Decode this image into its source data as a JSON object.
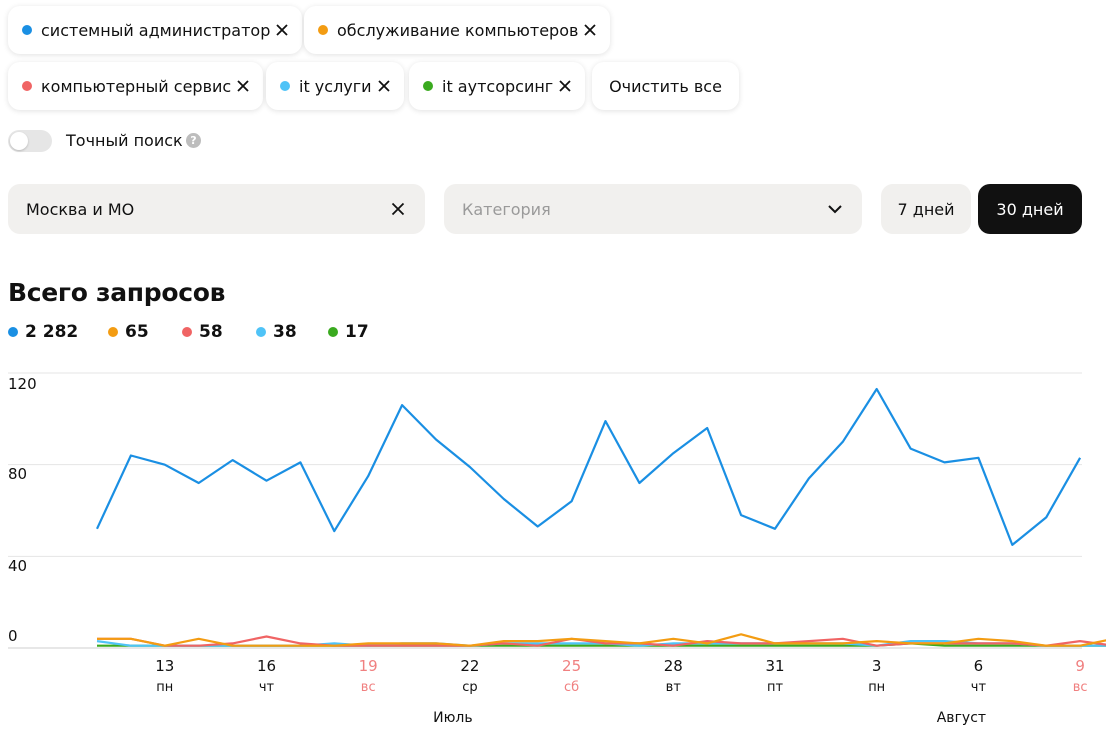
{
  "tags": [
    {
      "label": "системный администратор",
      "color": "#1a8fe3"
    },
    {
      "label": "обслуживание компьютеров",
      "color": "#f39c12"
    },
    {
      "label": "компьютерный сервис",
      "color": "#f06464"
    },
    {
      "label": "it услуги",
      "color": "#4fc3f7"
    },
    {
      "label": "it аутсорсинг",
      "color": "#3aaa1f"
    }
  ],
  "clear_all_label": "Очистить все",
  "exact_search_label": "Точный поиск",
  "help_glyph": "?",
  "region": {
    "value": "Москва и МО"
  },
  "category": {
    "placeholder": "Категория"
  },
  "period": {
    "seven_days": "7 дней",
    "thirty_days": "30 дней",
    "selected": "30 дней"
  },
  "totals_title": "Всего запросов",
  "totals": [
    {
      "value": "2 282",
      "color": "#1a8fe3"
    },
    {
      "value": "65",
      "color": "#f39c12"
    },
    {
      "value": "58",
      "color": "#f06464"
    },
    {
      "value": "38",
      "color": "#4fc3f7"
    },
    {
      "value": "17",
      "color": "#3aaa1f"
    }
  ],
  "chart_data": {
    "type": "line",
    "x": [
      "11",
      "12",
      "13",
      "14",
      "15",
      "16",
      "17",
      "18",
      "19",
      "20",
      "21",
      "22",
      "23",
      "24",
      "25",
      "26",
      "27",
      "28",
      "29",
      "30",
      "31",
      "1",
      "2",
      "3",
      "4",
      "5",
      "6",
      "7",
      "8",
      "9",
      "10"
    ],
    "y_ticks": [
      0,
      40,
      80,
      120
    ],
    "ylim": [
      0,
      120
    ],
    "x_tick_labels": [
      {
        "day": "13",
        "weekday": "пн",
        "weekend": false
      },
      {
        "day": "16",
        "weekday": "чт",
        "weekend": false
      },
      {
        "day": "19",
        "weekday": "вс",
        "weekend": true
      },
      {
        "day": "22",
        "weekday": "ср",
        "weekend": false
      },
      {
        "day": "25",
        "weekday": "сб",
        "weekend": true
      },
      {
        "day": "28",
        "weekday": "вт",
        "weekend": false
      },
      {
        "day": "31",
        "weekday": "пт",
        "weekend": false
      },
      {
        "day": "3",
        "weekday": "пн",
        "weekend": false
      },
      {
        "day": "6",
        "weekday": "чт",
        "weekend": false
      },
      {
        "day": "9",
        "weekday": "вс",
        "weekend": true
      }
    ],
    "months": [
      {
        "label": "Июль",
        "at": "22"
      },
      {
        "label": "Август",
        "at": "6"
      }
    ],
    "grid": true,
    "weekend_color": "#f08080",
    "series": [
      {
        "color": "#1a8fe3",
        "values": [
          52,
          84,
          80,
          72,
          82,
          73,
          81,
          51,
          75,
          106,
          91,
          79,
          65,
          53,
          64,
          99,
          72,
          85,
          96,
          58,
          52,
          74,
          90,
          113,
          87,
          81,
          83,
          45,
          57,
          83
        ]
      },
      {
        "color": "#f39c12",
        "values": [
          4,
          4,
          1,
          4,
          1,
          1,
          1,
          1,
          2,
          2,
          2,
          1,
          3,
          3,
          4,
          3,
          2,
          4,
          2,
          6,
          2,
          2,
          2,
          3,
          2,
          2,
          4,
          3,
          1,
          1,
          4
        ]
      },
      {
        "color": "#f06464",
        "values": [
          4,
          4,
          1,
          1,
          2,
          5,
          2,
          1,
          1,
          1,
          1,
          1,
          2,
          1,
          4,
          2,
          2,
          1,
          3,
          2,
          2,
          3,
          4,
          1,
          2,
          2,
          2,
          2,
          1,
          3,
          1
        ]
      },
      {
        "color": "#4fc3f7",
        "values": [
          3,
          1,
          1,
          1,
          1,
          1,
          1,
          2,
          1,
          2,
          2,
          1,
          2,
          2,
          2,
          2,
          1,
          2,
          2,
          2,
          2,
          2,
          2,
          1,
          3,
          3,
          2,
          2,
          1,
          1,
          1
        ]
      },
      {
        "color": "#3aaa1f",
        "values": [
          1,
          1,
          1,
          1,
          1,
          1,
          1,
          1,
          1,
          1,
          1,
          1,
          1,
          1,
          1,
          1,
          1,
          1,
          1,
          1,
          1,
          1,
          1,
          1,
          2,
          1,
          1,
          1,
          1,
          1,
          1
        ]
      }
    ]
  }
}
